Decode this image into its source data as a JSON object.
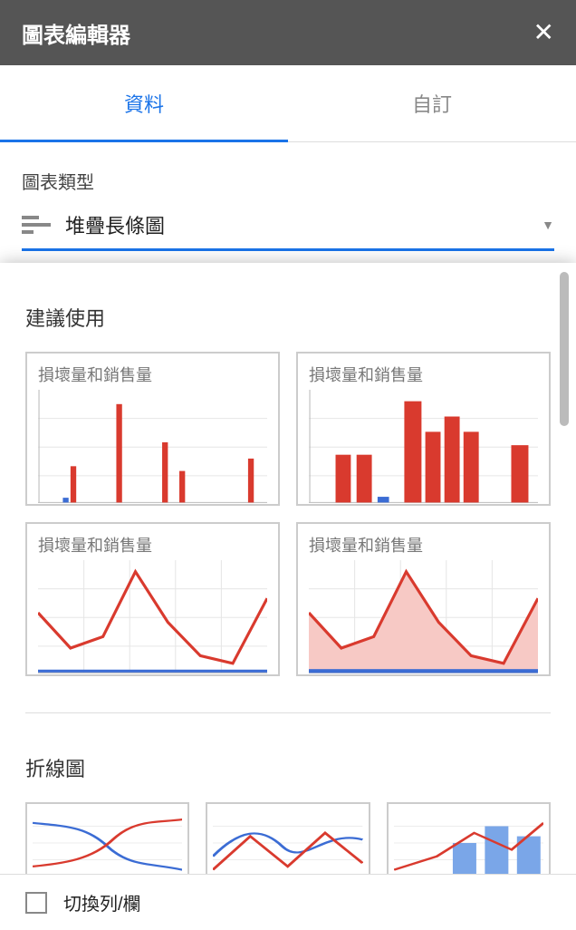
{
  "header": {
    "title": "圖表編輯器"
  },
  "tabs": {
    "data": "資料",
    "custom": "自訂",
    "active": "data"
  },
  "selector": {
    "label": "圖表類型",
    "selected": "堆疊長條圖"
  },
  "dropdown": {
    "suggested_title": "建議使用",
    "line_title": "折線圖",
    "thumbs": [
      {
        "label": "損壞量和銷售量"
      },
      {
        "label": "損壞量和銷售量"
      },
      {
        "label": "損壞量和銷售量"
      },
      {
        "label": "損壞量和銷售量"
      }
    ]
  },
  "footer": {
    "swap_label": "切換列/欄",
    "checked": false
  },
  "chart_data": [
    {
      "type": "bar",
      "title": "損壞量和銷售量",
      "series": [
        {
          "name": "blue",
          "values": [
            0,
            3,
            0,
            0,
            0,
            0,
            0,
            0,
            0,
            0
          ]
        },
        {
          "name": "red",
          "values": [
            0,
            30,
            0,
            90,
            0,
            50,
            25,
            0,
            0,
            35
          ]
        }
      ]
    },
    {
      "type": "bar",
      "title": "損壞量和銷售量",
      "series": [
        {
          "name": "blue",
          "values": [
            0,
            0,
            5,
            0,
            0,
            0,
            0,
            0,
            0,
            0
          ]
        },
        {
          "name": "red",
          "values": [
            0,
            40,
            40,
            0,
            95,
            60,
            75,
            60,
            0,
            50
          ]
        }
      ]
    },
    {
      "type": "line",
      "title": "損壞量和銷售量",
      "series": [
        {
          "name": "blue",
          "y": [
            2,
            2,
            2,
            2,
            2,
            2,
            2,
            2
          ]
        },
        {
          "name": "red",
          "y": [
            50,
            20,
            30,
            95,
            40,
            15,
            10,
            70
          ]
        }
      ]
    },
    {
      "type": "area",
      "title": "損壞量和銷售量",
      "series": [
        {
          "name": "blue",
          "y": [
            2,
            2,
            2,
            2,
            2,
            2,
            2,
            2
          ]
        },
        {
          "name": "red",
          "y": [
            50,
            20,
            30,
            95,
            40,
            15,
            10,
            70
          ]
        }
      ]
    }
  ]
}
